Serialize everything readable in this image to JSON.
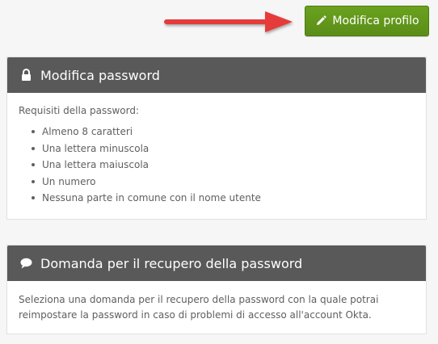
{
  "header": {
    "edit_button_label": "Modifica profilo",
    "edit_button_icon": "pencil-icon",
    "edit_button_color": "#5f961a",
    "annotation_arrow_color": "#e63b3b"
  },
  "password_panel": {
    "title": "Modifica password",
    "icon": "lock-icon",
    "requirements_title": "Requisiti della password:",
    "requirements": [
      "Almeno 8 caratteri",
      "Una lettera minuscola",
      "Una lettera maiuscola",
      "Un numero",
      "Nessuna parte in comune con il nome utente"
    ]
  },
  "recovery_panel": {
    "title": "Domanda per il recupero della password",
    "icon": "speech-bubble-icon",
    "description": "Seleziona una domanda per il recupero della password con la quale potrai reimpostare la password in caso di problemi di accesso all'account Okta."
  }
}
